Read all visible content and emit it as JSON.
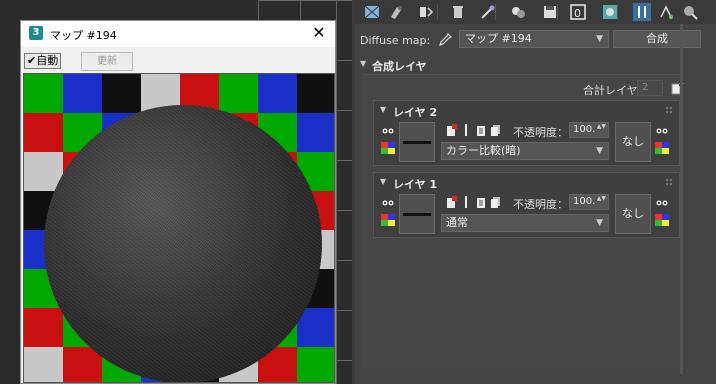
{
  "preview_window": {
    "title": "マップ #194",
    "app_icon_text": "3",
    "close_glyph": "✕",
    "auto_label": "✔自動",
    "update_label": "更新",
    "checker_colors": [
      [
        "#00a800",
        "#1a2ec8",
        "#101010",
        "#c8c8c8",
        "#c81010",
        "#00a800",
        "#1a2ec8",
        "#101010"
      ],
      [
        "#c81010",
        "#00a800",
        "#1a2ec8",
        "#101010",
        "#c8c8c8",
        "#c81010",
        "#00a800",
        "#1a2ec8"
      ],
      [
        "#c8c8c8",
        "#c81010",
        "#00a800",
        "#1a2ec8",
        "#101010",
        "#c8c8c8",
        "#c81010",
        "#00a800"
      ],
      [
        "#101010",
        "#c8c8c8",
        "#c81010",
        "#00a800",
        "#1a2ec8",
        "#101010",
        "#c8c8c8",
        "#c81010"
      ],
      [
        "#1a2ec8",
        "#101010",
        "#c8c8c8",
        "#c81010",
        "#00a800",
        "#1a2ec8",
        "#101010",
        "#c8c8c8"
      ],
      [
        "#00a800",
        "#1a2ec8",
        "#101010",
        "#c8c8c8",
        "#c81010",
        "#00a800",
        "#1a2ec8",
        "#101010"
      ],
      [
        "#c81010",
        "#00a800",
        "#1a2ec8",
        "#101010",
        "#c8c8c8",
        "#c81010",
        "#00a800",
        "#1a2ec8"
      ],
      [
        "#c8c8c8",
        "#c81010",
        "#00a800",
        "#1a2ec8",
        "#101010",
        "#c8c8c8",
        "#c81010",
        "#00a800"
      ]
    ]
  },
  "toolbar": {
    "icons": [
      "show-map-icon",
      "paint-icon",
      "assign-material-icon",
      "delete-icon",
      "magic-wand-icon",
      "material-ball-icon",
      "save-icon",
      "map-id-icon",
      "background-icon",
      "active-tool-icon",
      "navigate-icon",
      "pick-icon"
    ],
    "active_color": "#3a6ea5"
  },
  "diffuse": {
    "label": "Diffuse map:",
    "map_name": "マップ #194",
    "type_button": "合成"
  },
  "rollout": {
    "title": "合成レイヤ",
    "total_layers_label": "合計レイヤ数：",
    "total_layers_value": "2"
  },
  "layers": [
    {
      "title": "レイヤ 2",
      "opacity_label": "不透明度：",
      "opacity_value": "100.",
      "blend_mode": "カラー比較(暗)",
      "mask_label": "なし"
    },
    {
      "title": "レイヤ 1",
      "opacity_label": "不透明度：",
      "opacity_value": "100.",
      "blend_mode": "通常",
      "mask_label": "なし"
    }
  ],
  "glyphs": {
    "collapse": "▼",
    "dropdown": "▼",
    "spin": "▲▼"
  }
}
